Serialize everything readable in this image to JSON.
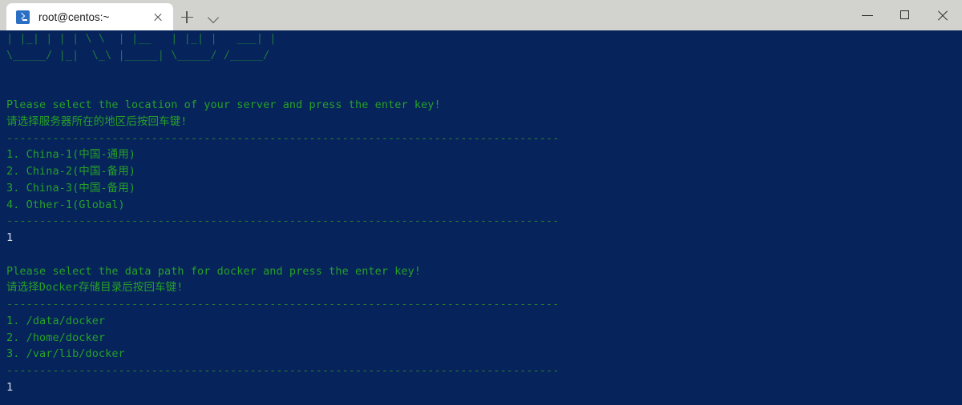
{
  "window": {
    "title": "root@centos:~",
    "tab_icon": "terminal-prompt-icon",
    "close_icon": "close-icon",
    "new_tab_icon": "plus-icon",
    "dropdown_icon": "chevron-down-icon",
    "minimize_icon": "minimize-icon",
    "maximize_icon": "maximize-icon",
    "window_close_icon": "close-icon"
  },
  "colors": {
    "terminal_background": "#06235c",
    "prompt_green": "#26a126",
    "ascii_art_green": "#1f7a3d",
    "input_text": "#d6dbe3",
    "titlebar_background": "#d2d2cf",
    "tab_background": "#ffffff",
    "tab_icon_blue": "#2b6fc4"
  },
  "terminal": {
    "lines": [
      {
        "name": "ascii-art-line-1",
        "style": "art",
        "text": "| |_| | | | \\ \\  | |__   | |_| |   ___| |"
      },
      {
        "name": "ascii-art-line-2",
        "style": "art",
        "text": "\\_____/ |_|  \\_\\ |_____| \\_____/ /_____/"
      },
      {
        "name": "blank-line",
        "style": "blank",
        "text": " "
      },
      {
        "name": "blank-line",
        "style": "blank",
        "text": " "
      },
      {
        "name": "prompt-location-en",
        "style": "green",
        "text": "Please select the location of your server and press the enter key!"
      },
      {
        "name": "prompt-location-zh",
        "style": "green",
        "text": "请选择服务器所在的地区后按回车键!"
      },
      {
        "name": "separator-line",
        "style": "sep",
        "text": "------------------------------------------------------------------------------------"
      },
      {
        "name": "menu-option-china-1",
        "style": "green",
        "text": "1. China-1(中国-通用)"
      },
      {
        "name": "menu-option-china-2",
        "style": "green",
        "text": "2. China-2(中国-备用)"
      },
      {
        "name": "menu-option-china-3",
        "style": "green",
        "text": "3. China-3(中国-备用)"
      },
      {
        "name": "menu-option-other-1",
        "style": "green",
        "text": "4. Other-1(Global)"
      },
      {
        "name": "separator-line",
        "style": "sep",
        "text": "------------------------------------------------------------------------------------"
      },
      {
        "name": "user-input-location",
        "style": "input",
        "text": "1"
      },
      {
        "name": "blank-line",
        "style": "blank",
        "text": " "
      },
      {
        "name": "prompt-datapath-en",
        "style": "green",
        "text": "Please select the data path for docker and press the enter key!"
      },
      {
        "name": "prompt-datapath-zh",
        "style": "green",
        "text": "请选择Docker存储目录后按回车键!"
      },
      {
        "name": "separator-line",
        "style": "sep",
        "text": "------------------------------------------------------------------------------------"
      },
      {
        "name": "menu-option-data-docker",
        "style": "green",
        "text": "1. /data/docker"
      },
      {
        "name": "menu-option-home-docker",
        "style": "green",
        "text": "2. /home/docker"
      },
      {
        "name": "menu-option-var-lib-docker",
        "style": "green",
        "text": "3. /var/lib/docker"
      },
      {
        "name": "separator-line",
        "style": "sep",
        "text": "------------------------------------------------------------------------------------"
      },
      {
        "name": "user-input-datapath",
        "style": "input",
        "text": "1"
      }
    ]
  }
}
